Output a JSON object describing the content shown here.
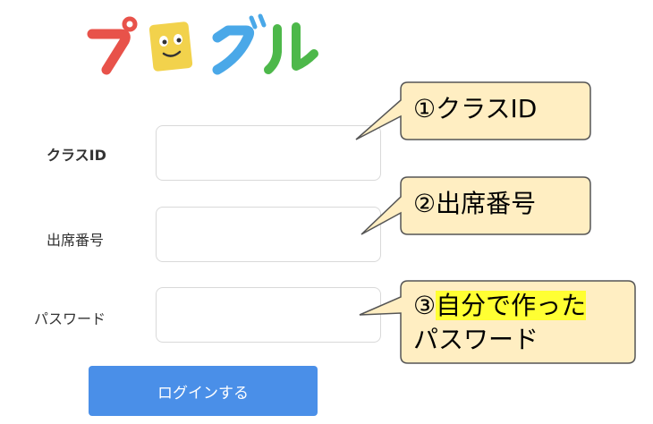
{
  "app": {
    "logo_text": "プログル"
  },
  "colors": {
    "logo_red": "#e8524a",
    "logo_yellow": "#f2d24c",
    "logo_blue": "#4aa8e8",
    "logo_green": "#4db84a",
    "button_blue": "#4a8fe8",
    "callout_fill": "#ffeec2",
    "highlight": "#ffff33"
  },
  "form": {
    "class_id_label": "クラスID",
    "seat_number_label": "出席番号",
    "password_label": "パスワード",
    "login_button": "ログインする"
  },
  "callouts": {
    "c1": "①クラスID",
    "c2": "②出席番号",
    "c3_prefix": "③",
    "c3_highlight": "自分で作った",
    "c3_line2": "パスワード"
  }
}
